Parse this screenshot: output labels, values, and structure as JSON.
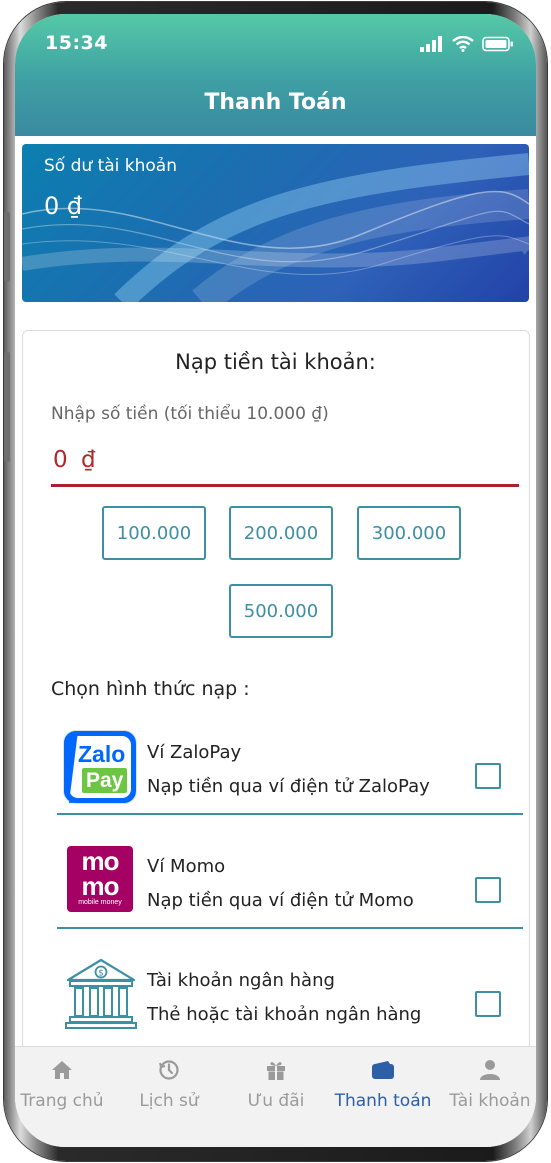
{
  "status_bar": {
    "time": "15:34"
  },
  "header": {
    "title": "Thanh Toán"
  },
  "balance": {
    "label": "Số dư tài khoản",
    "value": "0 ₫"
  },
  "topup": {
    "title": "Nạp tiền tài khoản:",
    "amount_label": "Nhập số tiền (tối thiểu 10.000 ₫)",
    "amount_value": "0 ₫",
    "presets": [
      "100.000",
      "200.000",
      "300.000",
      "500.000"
    ]
  },
  "methods": {
    "heading": "Chọn hình thức nạp :",
    "items": [
      {
        "name": "Ví ZaloPay",
        "desc": "Nạp tiền qua ví điện tử ZaloPay",
        "logo": "zalopay-logo",
        "checked": false
      },
      {
        "name": "Ví Momo",
        "desc": "Nạp tiền qua ví điện tử Momo",
        "logo": "momo-logo",
        "checked": false
      },
      {
        "name": "Tài khoản ngân hàng",
        "desc": "Thẻ hoặc tài khoản ngân hàng",
        "logo": "bank-icon",
        "checked": false
      }
    ]
  },
  "logos": {
    "zalopay": {
      "line1": "Zalo",
      "line2": "Pay"
    },
    "momo": {
      "line1": "mo",
      "line2": "mo",
      "tagline": "mobile money"
    }
  },
  "tabbar": {
    "items": [
      {
        "label": "Trang chủ",
        "icon": "home-icon"
      },
      {
        "label": "Lịch sử",
        "icon": "history-icon"
      },
      {
        "label": "Ưu đãi",
        "icon": "gift-icon"
      },
      {
        "label": "Thanh toán",
        "icon": "wallet-icon",
        "active": true
      },
      {
        "label": "Tài khoản",
        "icon": "user-icon"
      }
    ]
  },
  "colors": {
    "header_top": "#55c9a6",
    "header_bottom": "#3b8aa0",
    "accent": "#3d8fa3",
    "input_underline": "#a8232b",
    "active_tab": "#2c5fa8",
    "inactive_tab": "#9a9a9a",
    "momo": "#a50064",
    "zalopay_blue": "#0068ff",
    "zalopay_green": "#6cc644"
  }
}
